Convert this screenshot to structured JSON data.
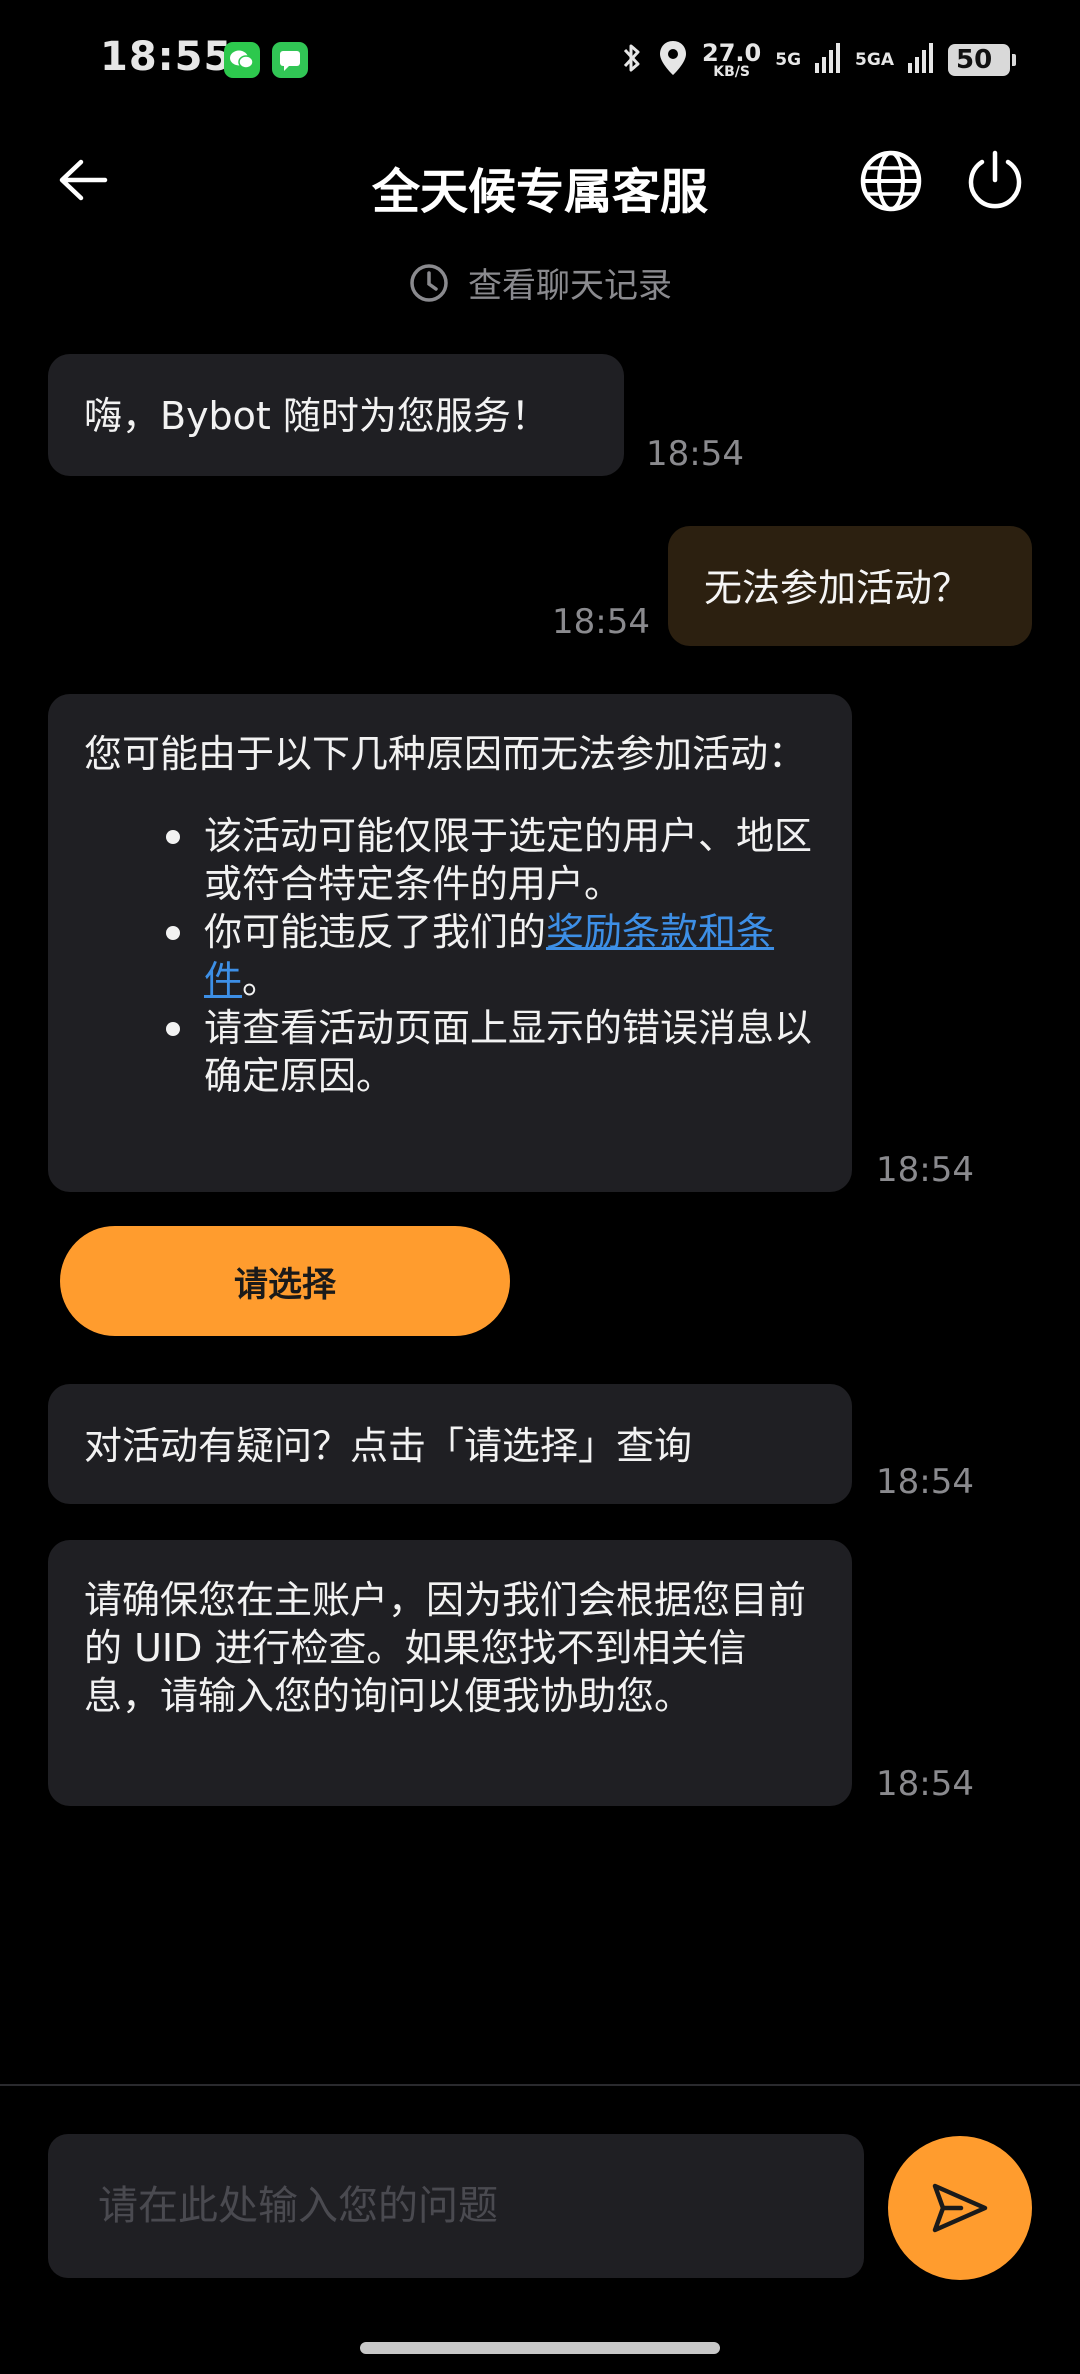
{
  "status_bar": {
    "time": "18:55",
    "speed_value": "27.0",
    "speed_unit": "KB/S",
    "net1": "5G",
    "net2": "5GA",
    "battery": "50",
    "icons": [
      "wechat-icon",
      "message-icon",
      "bluetooth-icon",
      "location-icon",
      "signal-icon",
      "signal-icon",
      "battery-icon"
    ]
  },
  "header": {
    "title": "全天候专属客服",
    "icons": [
      "back-arrow-icon",
      "globe-icon",
      "power-icon"
    ]
  },
  "history": {
    "label": "查看聊天记录",
    "icon": "clock-icon"
  },
  "messages": {
    "m1": {
      "text": "嗨，Bybot 随时为您服务！",
      "time": "18:54"
    },
    "m2": {
      "text": "无法参加活动？",
      "time": "18:54"
    },
    "m3": {
      "intro": "您可能由于以下几种原因而无法参加活动：",
      "bullet1": "该活动可能仅限于选定的用户、地区或符合特定条件的用户。",
      "bullet2_prefix": "你可能违反了我们的",
      "bullet2_link": "奖励条款和条件",
      "bullet2_suffix": "。",
      "bullet3": "请查看活动页面上显示的错误消息以确定原因。",
      "time": "18:54"
    },
    "choose_button": "请选择",
    "m4": {
      "text": "对活动有疑问？点击「请选择」查询",
      "time": "18:54"
    },
    "m5": {
      "text": "请确保您在主账户，因为我们会根据您目前的 UID 进行检查。如果您找不到相关信息，请输入您的询问以便我协助您。",
      "time": "18:54"
    }
  },
  "composer": {
    "placeholder": "请在此处输入您的问题",
    "send_icon": "send-icon"
  },
  "colors": {
    "accent": "#ff9c2e",
    "bubble_bot": "#1f1f23",
    "bubble_user": "#2c2010",
    "link": "#3d8fe6",
    "muted": "#8a8a8e"
  }
}
